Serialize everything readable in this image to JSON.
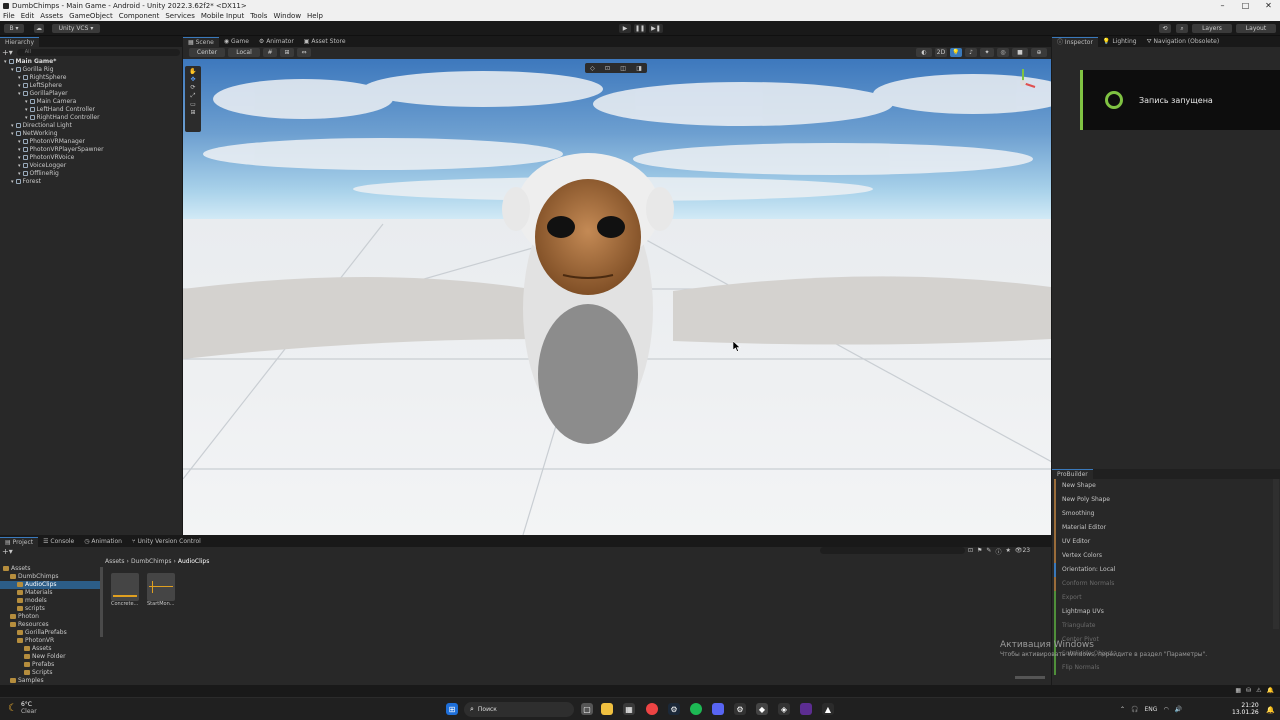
{
  "window": {
    "title": "DumbChimps - Main Game - Android - Unity 2022.3.62f2* <DX11>",
    "controls": [
      "–",
      "□",
      "✕"
    ]
  },
  "menu": [
    "File",
    "Edit",
    "Assets",
    "GameObject",
    "Component",
    "Services",
    "Mobile Input",
    "Tools",
    "Window",
    "Help"
  ],
  "toolbar": {
    "account": "B ▾",
    "vcs": "Unity VCS ▾",
    "play": "▶",
    "pause": "❚❚",
    "step": "▶❚",
    "layers": "Layers",
    "layout": "Layout"
  },
  "hierarchy": {
    "tab": "Hierarchy",
    "search_placeholder": "All",
    "items": [
      {
        "label": "Main Game*",
        "depth": 0
      },
      {
        "label": "Gorilla Rig",
        "depth": 1
      },
      {
        "label": "RightSphere",
        "depth": 2
      },
      {
        "label": "LeftSphere",
        "depth": 2
      },
      {
        "label": "GorillaPlayer",
        "depth": 2
      },
      {
        "label": "Main Camera",
        "depth": 3
      },
      {
        "label": "LeftHand Controller",
        "depth": 3
      },
      {
        "label": "RightHand Controller",
        "depth": 3
      },
      {
        "label": "Directional Light",
        "depth": 1
      },
      {
        "label": "NetWorking",
        "depth": 1
      },
      {
        "label": "PhotonVRManager",
        "depth": 2
      },
      {
        "label": "PhotonVRPlayerSpawner",
        "depth": 2
      },
      {
        "label": "PhotonVRVoice",
        "depth": 2
      },
      {
        "label": "VoiceLogger",
        "depth": 2
      },
      {
        "label": "OfflineRig",
        "depth": 2
      },
      {
        "label": "Forest",
        "depth": 1
      }
    ]
  },
  "scene": {
    "tabs": [
      "Scene",
      "Game",
      "Animator",
      "Asset Store"
    ],
    "pivot": "Center",
    "space": "Local",
    "mode_2d": "2D"
  },
  "inspector": {
    "tabs": [
      "Inspector",
      "Lighting",
      "Navigation (Obsolete)"
    ]
  },
  "recording": {
    "text": "Запись запущена"
  },
  "probuilder": {
    "title": "ProBuilder",
    "items": [
      {
        "label": "New Shape",
        "dim": false
      },
      {
        "label": "New Poly Shape",
        "dim": false
      },
      {
        "label": "Smoothing",
        "dim": false
      },
      {
        "label": "Material Editor",
        "dim": false
      },
      {
        "label": "UV Editor",
        "dim": false
      },
      {
        "label": "Vertex Colors",
        "dim": false
      },
      {
        "label": "Orientation: Local",
        "dim": false
      },
      {
        "label": "Conform Normals",
        "dim": true
      },
      {
        "label": "Export",
        "dim": true
      },
      {
        "label": "Lightmap UVs",
        "dim": false
      },
      {
        "label": "Triangulate",
        "dim": true
      },
      {
        "label": "Center Pivot",
        "dim": true
      },
      {
        "label": "Subdivide Object",
        "dim": true
      },
      {
        "label": "Flip Normals",
        "dim": true
      }
    ]
  },
  "project": {
    "tabs": [
      "Project",
      "Console",
      "Animation",
      "Unity Version Control"
    ],
    "breadcrumb": [
      "Assets",
      "DumbChimps",
      "AudioClips"
    ],
    "tree": [
      {
        "label": "Assets",
        "depth": 0
      },
      {
        "label": "DumbChimps",
        "depth": 1
      },
      {
        "label": "AudioClips",
        "depth": 2,
        "selected": true
      },
      {
        "label": "Materials",
        "depth": 2
      },
      {
        "label": "models",
        "depth": 2
      },
      {
        "label": "scripts",
        "depth": 2
      },
      {
        "label": "Photon",
        "depth": 1
      },
      {
        "label": "Resources",
        "depth": 1
      },
      {
        "label": "GorillaPrefabs",
        "depth": 2
      },
      {
        "label": "PhotonVR",
        "depth": 2
      },
      {
        "label": "Assets",
        "depth": 3
      },
      {
        "label": "New Folder",
        "depth": 3
      },
      {
        "label": "Prefabs",
        "depth": 3
      },
      {
        "label": "Scripts",
        "depth": 3
      },
      {
        "label": "Samples",
        "depth": 1
      }
    ],
    "assets": [
      {
        "label": "Concrete..."
      },
      {
        "label": "StartMon..."
      }
    ],
    "count": "23"
  },
  "activation": {
    "title": "Активация Windows",
    "subtitle": "Чтобы активировать Windows, перейдите в раздел \"Параметры\"."
  },
  "taskbar": {
    "weather_temp": "6°C",
    "weather_text": "Clear",
    "search": "Поиск",
    "lang": "ENG",
    "time": "21:20",
    "date": "13.01.26"
  },
  "colors": {
    "accent": "#3a79bb",
    "recording": "#7fc242",
    "probuilder_bar": "#9a6c3a"
  }
}
